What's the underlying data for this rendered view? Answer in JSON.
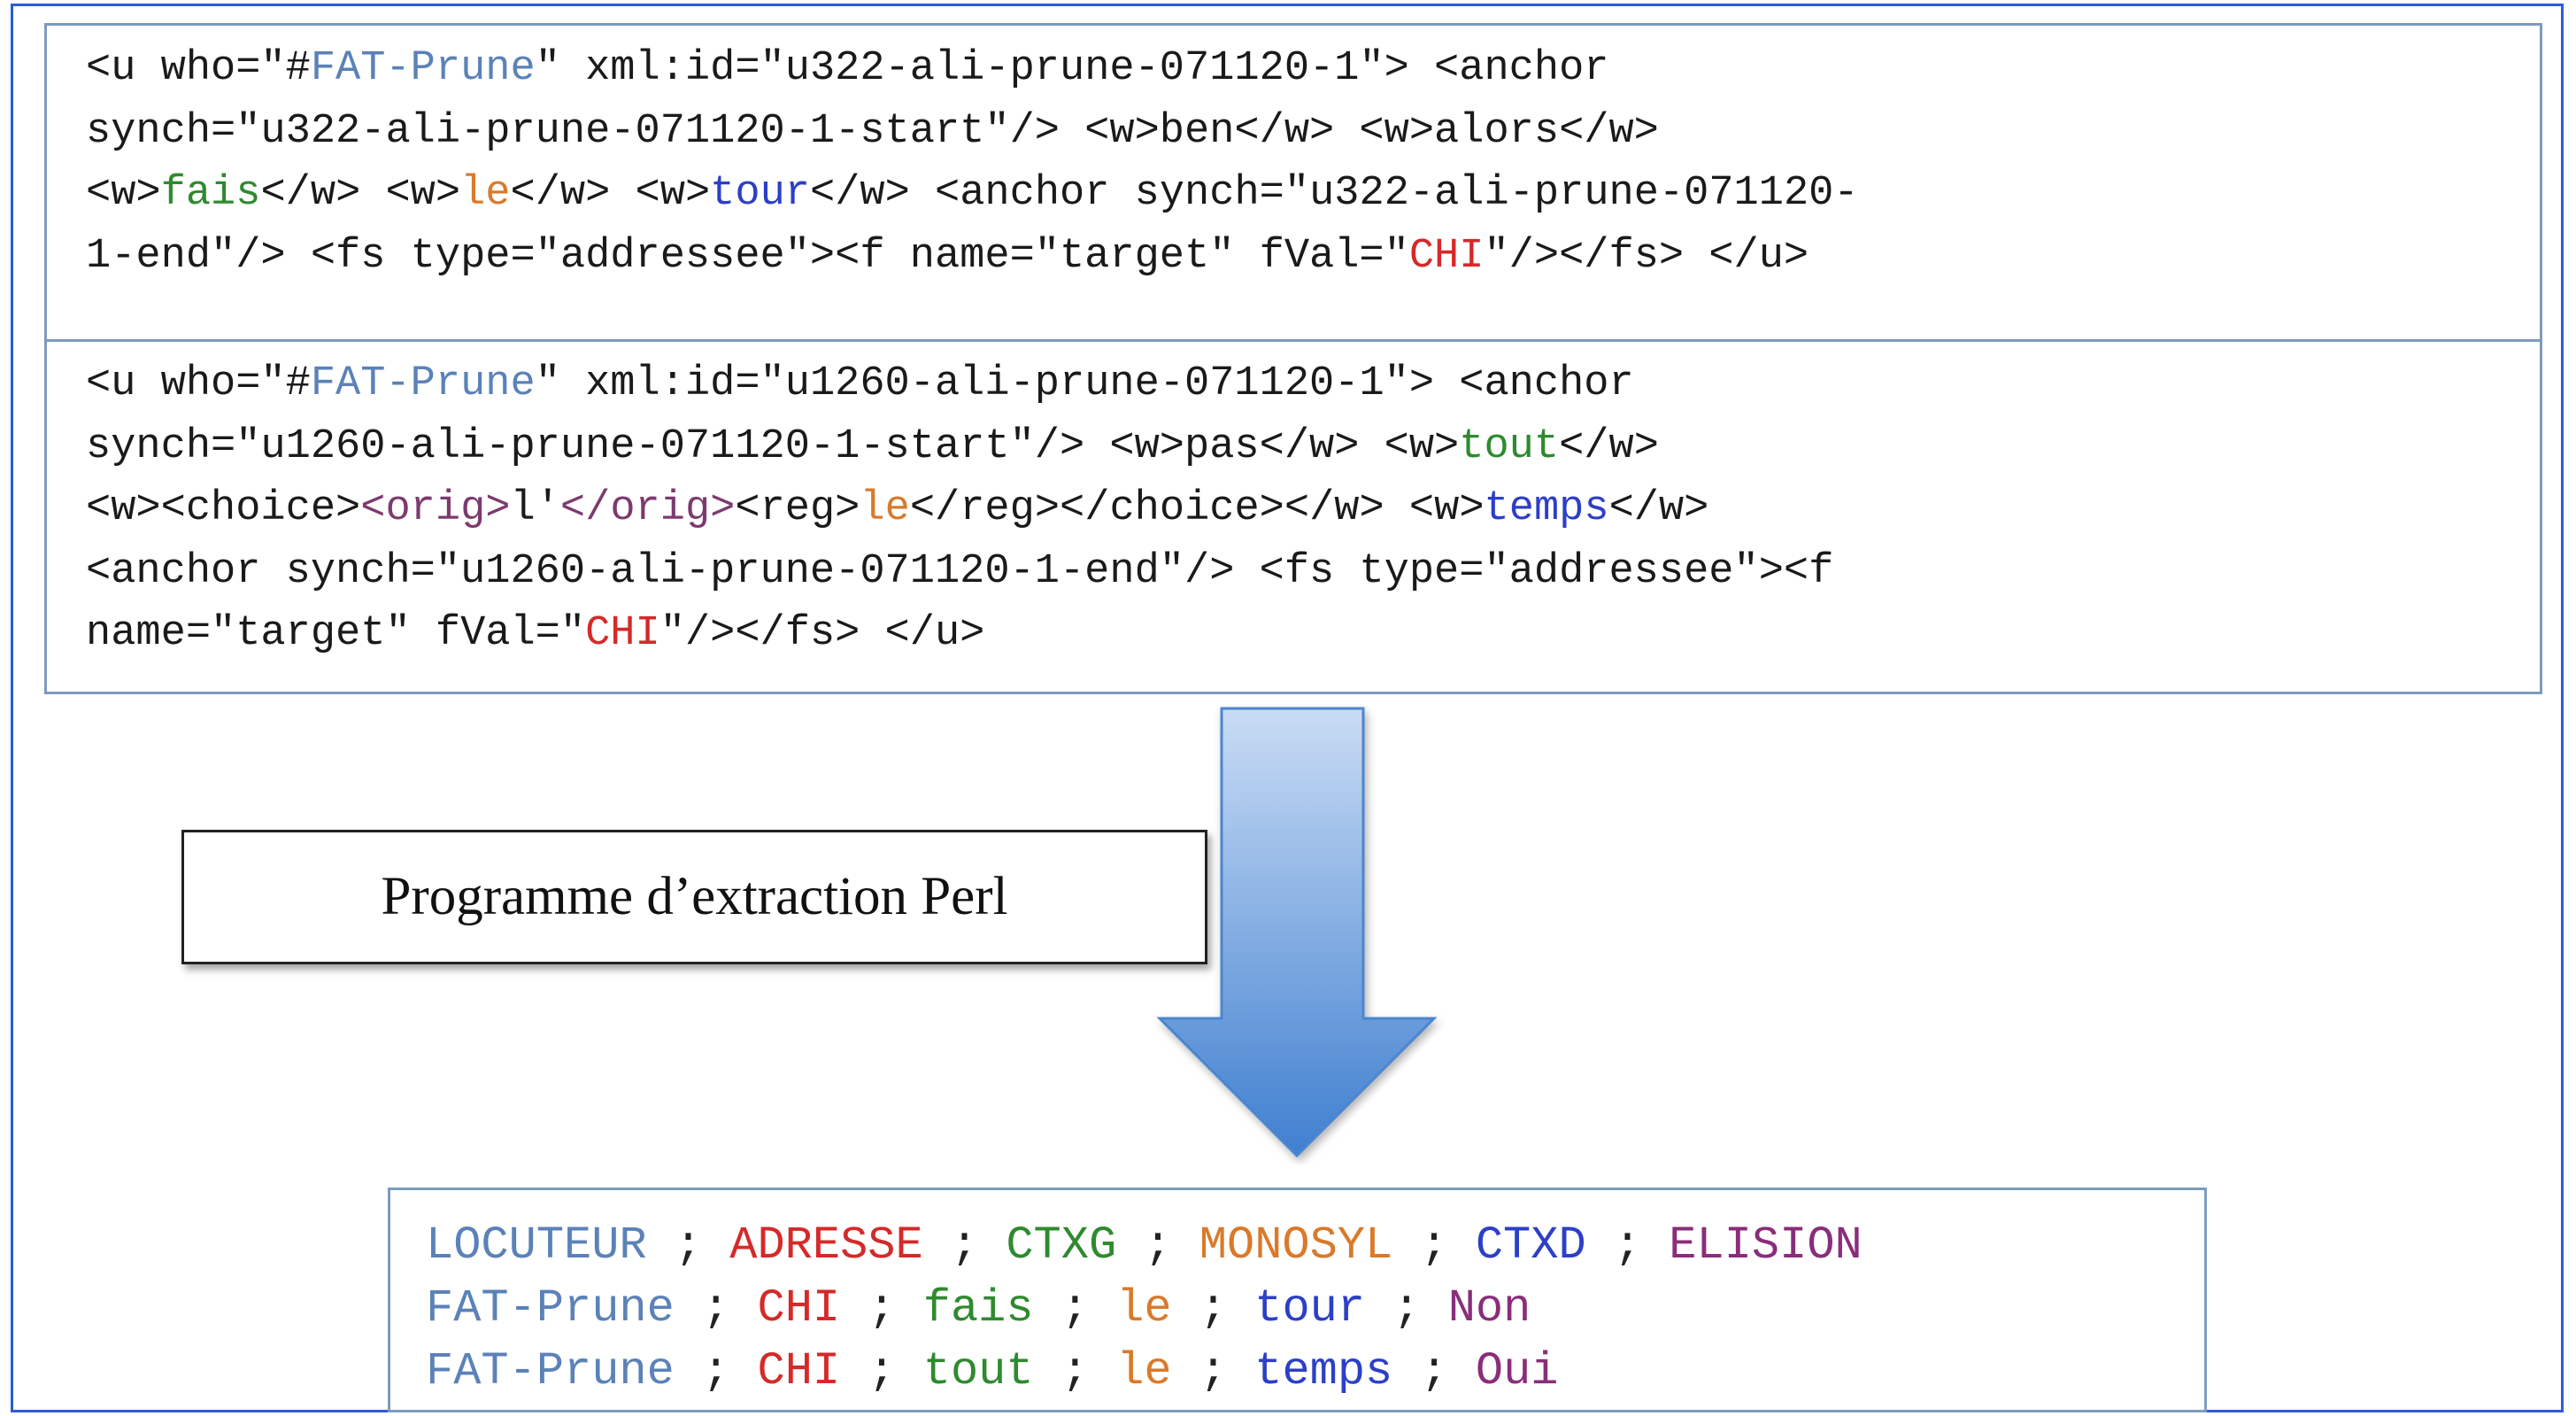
{
  "xml_block_1": {
    "l1_a": "<u who=\"#",
    "l1_b": "FAT-Prune",
    "l1_c": "\" xml:id=\"u322-ali-prune-071120-1\"> <anchor",
    "l2": "synch=\"u322-ali-prune-071120-1-start\"/> <w>ben</w> <w>alors</w>",
    "l3_a": "<w>",
    "l3_b": "fais",
    "l3_c": "</w> <w>",
    "l3_d": "le",
    "l3_e": "</w> <w>",
    "l3_f": "tour",
    "l3_g": "</w> <anchor synch=\"u322-ali-prune-071120-",
    "l4_a": "1-end\"/> <fs type=\"addressee\"><f name=\"target\" fVal=\"",
    "l4_b": "CHI",
    "l4_c": "\"/></fs> </u>"
  },
  "xml_block_2": {
    "l1_a": "<u who=\"#",
    "l1_b": "FAT-Prune",
    "l1_c": "\" xml:id=\"u1260-ali-prune-071120-1\"> <anchor",
    "l2_a": "synch=\"u1260-ali-prune-071120-1-start\"/> <w>pas</w> <w>",
    "l2_b": "tout",
    "l2_c": "</w>",
    "l3_a": "<w><choice>",
    "l3_b": "<orig>",
    "l3_c": "l'",
    "l3_d": "</orig>",
    "l3_e": "<reg>",
    "l3_f": "le",
    "l3_g": "</reg></choice></w> <w>",
    "l3_h": "temps",
    "l3_i": "</w>",
    "l4": "<anchor synch=\"u1260-ali-prune-071120-1-end\"/> <fs type=\"addressee\"><f",
    "l5_a": "name=\"target\" fVal=\"",
    "l5_b": "CHI",
    "l5_c": "\"/></fs> </u>"
  },
  "process_label": "Programme d’extraction Perl",
  "output": {
    "header": [
      "LOCUTEUR",
      "ADRESSE",
      "CTXG",
      "MONOSYL",
      "CTXD",
      "ELISION"
    ],
    "rows": [
      [
        "FAT-Prune",
        "CHI",
        "fais",
        "le",
        "tour",
        "Non"
      ],
      [
        "FAT-Prune",
        "CHI",
        "tout",
        "le",
        "temps",
        "Oui"
      ]
    ],
    "separator": " ; "
  },
  "colors": {
    "frame": "#2f5bd8",
    "box_border": "#7d9ac0",
    "speaker": "#5b82b8",
    "left_context": "#2f8a2f",
    "monosyllable": "#d97a2b",
    "right_context": "#2c3fc7",
    "addressee": "#d42a2a",
    "elision": "#8a2d7a",
    "arrow_top": "#c9dcf4",
    "arrow_bottom": "#3f7fd0"
  }
}
